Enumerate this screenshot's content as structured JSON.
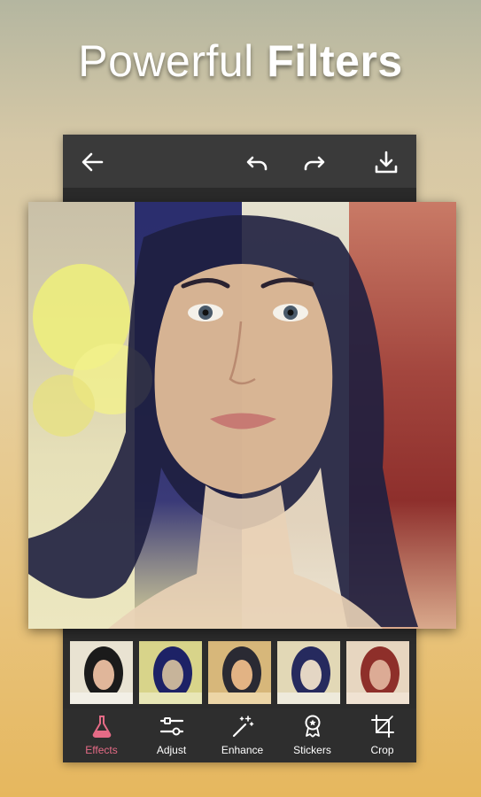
{
  "headline": {
    "light": "Powerful ",
    "bold": "Filters"
  },
  "topbar": {
    "back": "arrow-left-icon",
    "undo": "undo-icon",
    "redo": "redo-icon",
    "download": "download-icon"
  },
  "filters": [
    {
      "name": "original",
      "color": "#d9c7a4"
    },
    {
      "name": "blue-yellow",
      "color": "#2d2f7a"
    },
    {
      "name": "warm",
      "color": "#d8a96a"
    },
    {
      "name": "cool-fade",
      "color": "#d8d6c4"
    },
    {
      "name": "red",
      "color": "#9a3d38"
    }
  ],
  "tools": [
    {
      "label": "Effects",
      "icon": "flask-icon",
      "active": true
    },
    {
      "label": "Adjust",
      "icon": "sliders-icon",
      "active": false
    },
    {
      "label": "Enhance",
      "icon": "magic-wand-icon",
      "active": false
    },
    {
      "label": "Stickers",
      "icon": "badge-icon",
      "active": false
    },
    {
      "label": "Crop",
      "icon": "crop-icon",
      "active": false
    }
  ],
  "colors": {
    "accent": "#e56b86",
    "toolbar": "#2e2e2e",
    "topbar": "#3a3a3a"
  }
}
